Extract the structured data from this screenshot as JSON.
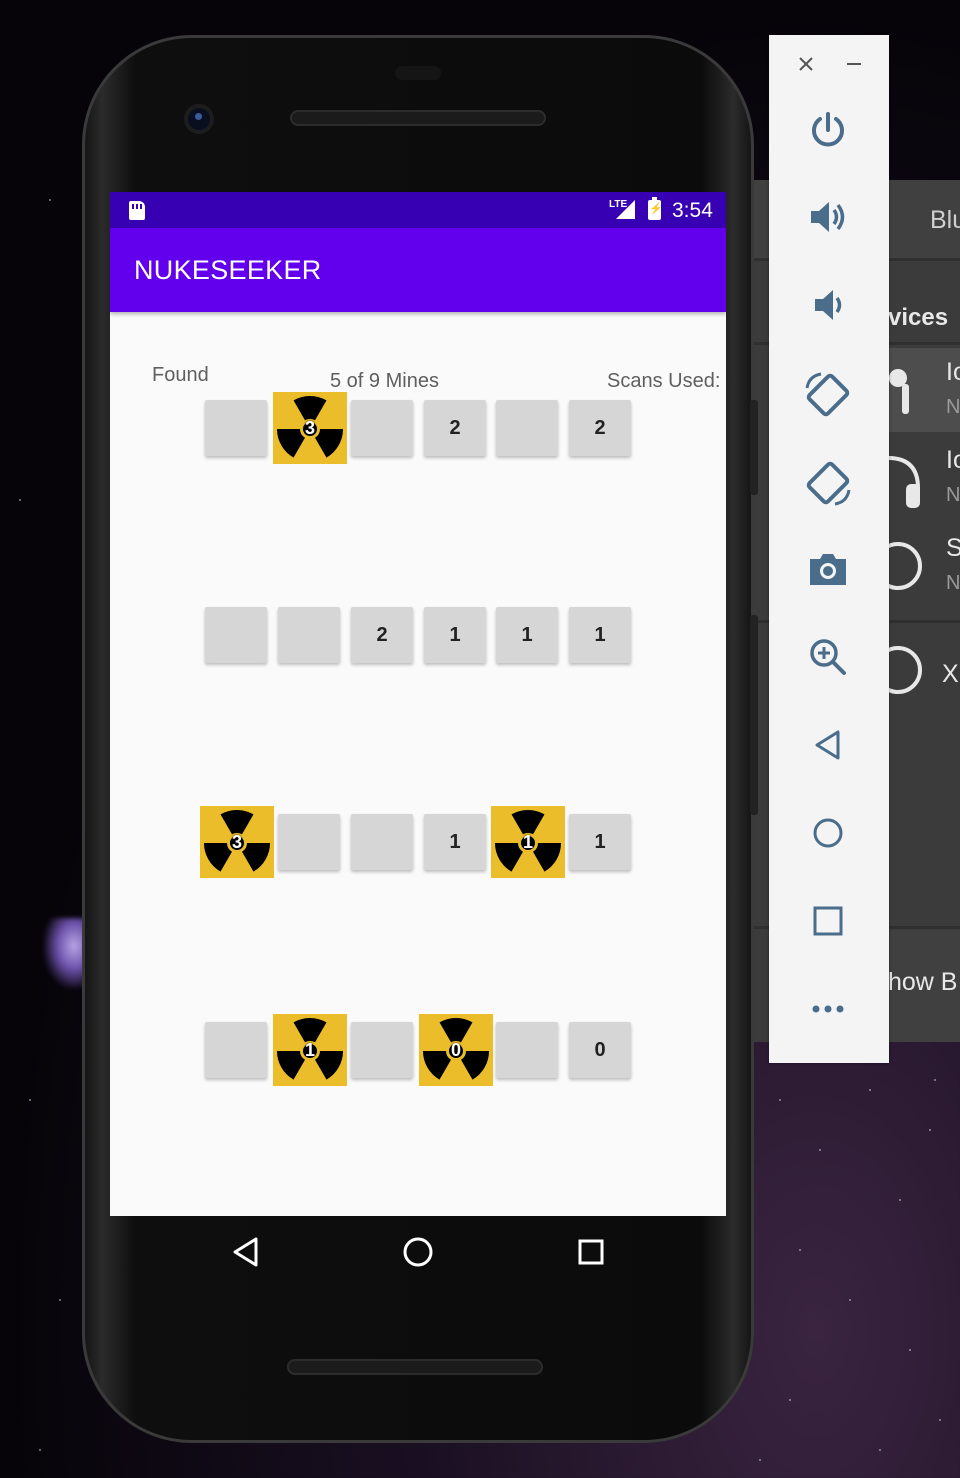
{
  "app": {
    "title": "NUKESEEKER",
    "status_time": "3:54",
    "network": "LTE"
  },
  "labels": {
    "found": "Found",
    "mines": "5 of 9 Mines",
    "scans": "Scans Used:"
  },
  "grid": [
    [
      {
        "type": "empty"
      },
      {
        "type": "mine",
        "count": "3"
      },
      {
        "type": "empty"
      },
      {
        "type": "number",
        "value": "2"
      },
      {
        "type": "empty"
      },
      {
        "type": "number",
        "value": "2"
      }
    ],
    [
      {
        "type": "empty"
      },
      {
        "type": "empty"
      },
      {
        "type": "number",
        "value": "2"
      },
      {
        "type": "number",
        "value": "1"
      },
      {
        "type": "number",
        "value": "1"
      },
      {
        "type": "number",
        "value": "1"
      }
    ],
    [
      {
        "type": "mine",
        "count": "3"
      },
      {
        "type": "empty"
      },
      {
        "type": "empty"
      },
      {
        "type": "number",
        "value": "1"
      },
      {
        "type": "mine",
        "count": "1"
      },
      {
        "type": "number",
        "value": "1"
      }
    ],
    [
      {
        "type": "empty"
      },
      {
        "type": "mine",
        "count": "1"
      },
      {
        "type": "empty"
      },
      {
        "type": "mine",
        "count": "0"
      },
      {
        "type": "empty"
      },
      {
        "type": "number",
        "value": "0"
      }
    ]
  ],
  "background_window": {
    "header": "Blu",
    "section": "vices",
    "items": [
      {
        "title": "Io",
        "sub": "N"
      },
      {
        "title": "Io",
        "sub": "N"
      },
      {
        "title": "S",
        "sub": "N"
      },
      {
        "title": "X",
        "sub": ""
      }
    ],
    "footer": "how B"
  },
  "emulator_panel": {
    "buttons": [
      "close-icon",
      "minimize-icon",
      "power-icon",
      "volume-up-icon",
      "volume-down-icon",
      "rotate-left-icon",
      "rotate-right-icon",
      "camera-icon",
      "zoom-icon",
      "back-icon",
      "home-icon",
      "overview-icon",
      "more-icon"
    ]
  },
  "colors": {
    "primary": "#6200ee",
    "primary_dark": "#3700b3",
    "mine_bg": "#ebbd2b",
    "cell_bg": "#d6d6d6"
  }
}
